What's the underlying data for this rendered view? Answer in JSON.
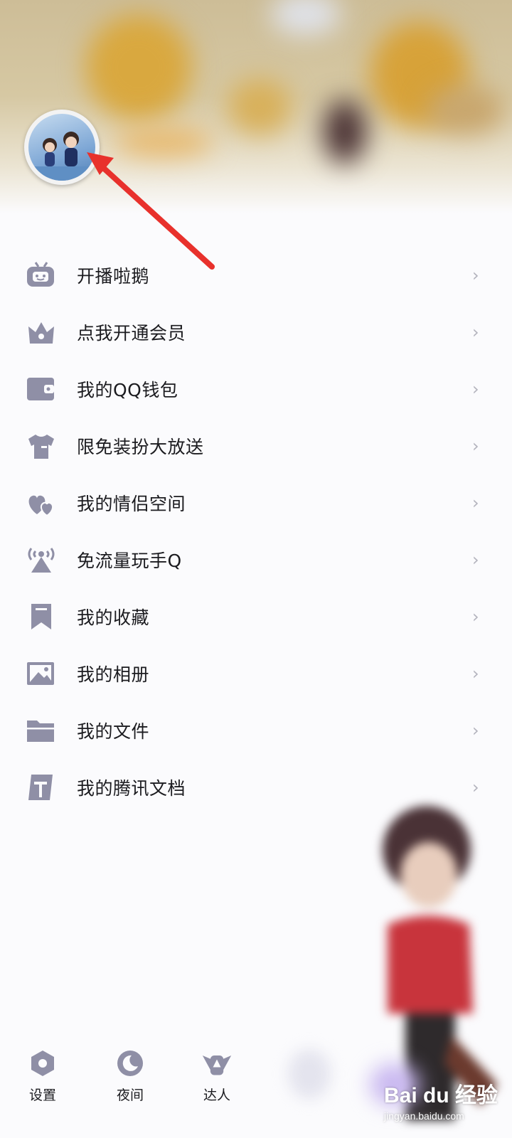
{
  "menu": {
    "items": [
      {
        "label": "开播啦鹅",
        "icon": "tv-icon"
      },
      {
        "label": "点我开通会员",
        "icon": "crown-bag-icon"
      },
      {
        "label": "我的QQ钱包",
        "icon": "wallet-icon"
      },
      {
        "label": "限免装扮大放送",
        "icon": "tshirt-icon"
      },
      {
        "label": "我的情侣空间",
        "icon": "hearts-icon"
      },
      {
        "label": "免流量玩手Q",
        "icon": "signal-tower-icon"
      },
      {
        "label": "我的收藏",
        "icon": "bookmark-icon"
      },
      {
        "label": "我的相册",
        "icon": "picture-icon"
      },
      {
        "label": "我的文件",
        "icon": "folder-icon"
      },
      {
        "label": "我的腾讯文档",
        "icon": "document-icon"
      }
    ],
    "chevron": "›"
  },
  "bottom_bar": {
    "settings": "设置",
    "night": "夜间",
    "talent": "达人"
  },
  "watermark": {
    "main": "Bai du 经验",
    "sub": "jingyan.baidu.com"
  },
  "colors": {
    "icon": "#8f8fa6",
    "text": "#1b1b1f",
    "arrow": "#e8312c",
    "chevron": "#b3b3bd"
  }
}
